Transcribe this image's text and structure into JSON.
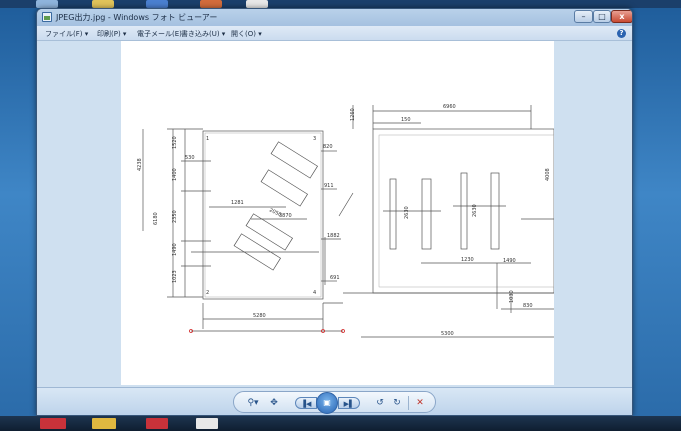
{
  "window": {
    "title": "JPEG出力.jpg - Windows フォト ビューアー",
    "minimize_glyph": "–",
    "maximize_glyph": "□",
    "close_glyph": "x"
  },
  "menu": {
    "file": "ファイル(F) ▾",
    "print": "印刷(P) ▾",
    "email": "電子メール(E)",
    "burn": "書き込み(U) ▾",
    "open": "開く(O) ▾",
    "help_glyph": "?"
  },
  "drawing": {
    "labels": [
      "1520",
      "530",
      "1400",
      "2350",
      "1490",
      "1023",
      "5280",
      "1281",
      "3870",
      "2050",
      "820",
      "911",
      "1882",
      "691",
      "6180",
      "4238",
      "6960",
      "150",
      "1260",
      "2630",
      "2630",
      "4008",
      "1230",
      "1490",
      "1030",
      "5300",
      "830",
      "1",
      "3",
      "2",
      "4"
    ]
  },
  "toolbar": {
    "zoom_glyph": "⚲▾",
    "fit_glyph": "✥",
    "prev_glyph": "▐◀",
    "play_glyph": "▣",
    "next_glyph": "▶▌",
    "rotate_left_glyph": "↺",
    "rotate_right_glyph": "↻",
    "delete_glyph": "✕"
  },
  "icons": {
    "app": "photo-viewer-icon",
    "help": "help-icon",
    "zoom": "magnifier-icon",
    "fit": "actual-size-icon",
    "prev": "previous-icon",
    "slideshow": "slideshow-icon",
    "next": "next-icon",
    "rotate_left": "rotate-counterclockwise-icon",
    "rotate_right": "rotate-clockwise-icon",
    "delete": "delete-icon"
  },
  "colors": {
    "titlebar": "#a5c1e0",
    "close": "#c84a33",
    "accent": "#2763b3",
    "drawing_red": "#d02020"
  }
}
